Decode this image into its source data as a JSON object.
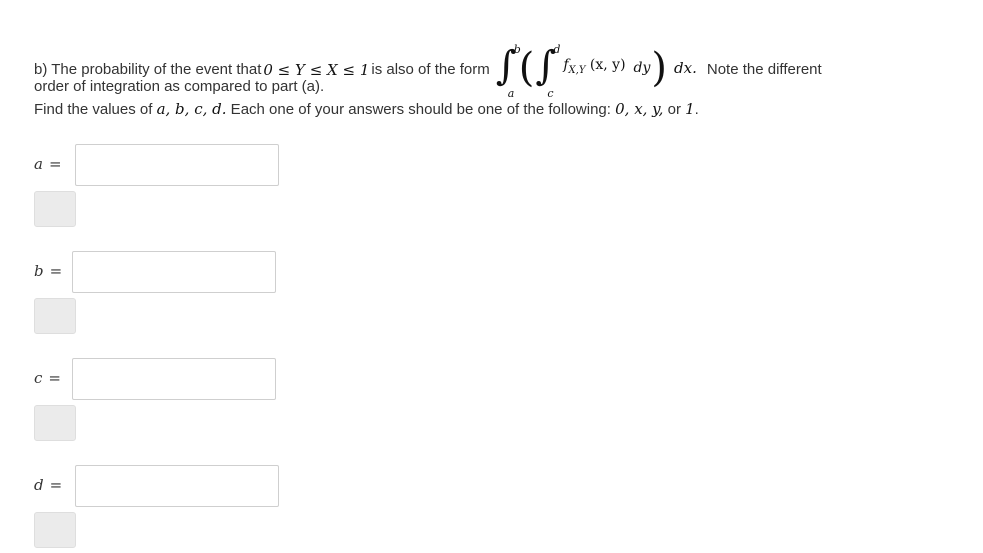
{
  "question": {
    "line1_prefix": "b) The probability of the event that ",
    "event": "0 ≤ Y ≤ X ≤ 1",
    "line1_mid": " is also of the form ",
    "integral": {
      "outer_upper": "b",
      "outer_lower": "a",
      "inner_upper": "d",
      "inner_lower": "c",
      "integrand_f": "f",
      "integrand_sub": "X,Y",
      "integrand_args": "(x, y)",
      "inner_diff": "dy",
      "outer_diff": "dx."
    },
    "line1_suffix": " Note the different",
    "line2": "order of integration as compared to part (a).",
    "line3_prefix": "Find the values of ",
    "line3_vars": "a, b, c, d.",
    "line3_mid": " Each one of your answers should be one of the following: ",
    "line3_options": "0, x, y,",
    "line3_or": " or ",
    "line3_last": "1",
    "line3_end": "."
  },
  "answers": [
    {
      "label": "a",
      "eq": "=",
      "value": ""
    },
    {
      "label": "b",
      "eq": "=",
      "value": ""
    },
    {
      "label": "c",
      "eq": "=",
      "value": ""
    },
    {
      "label": "d",
      "eq": "=",
      "value": ""
    }
  ]
}
